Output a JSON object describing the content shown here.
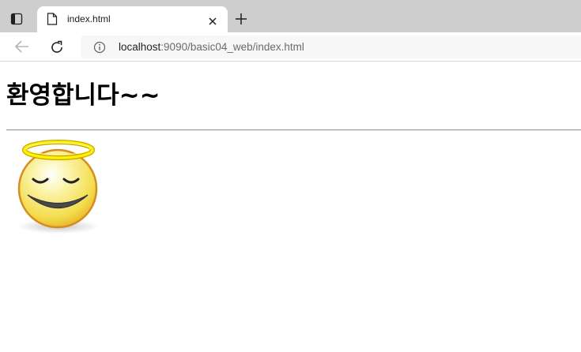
{
  "browser": {
    "tab": {
      "title": "index.html"
    },
    "address": {
      "host": "localhost",
      "rest": ":9090/basic04_web/index.html"
    }
  },
  "page": {
    "heading": "환영합니다~~",
    "image": {
      "icon": "angel-smiley-icon"
    }
  }
}
